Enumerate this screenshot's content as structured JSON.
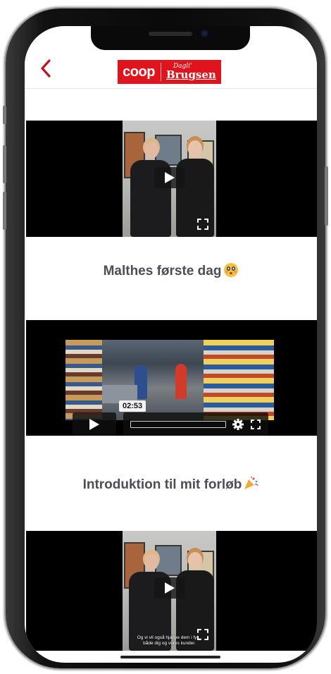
{
  "header": {
    "back_icon": "chevron-left-icon",
    "logo": {
      "primary": "coop",
      "secondary_top": "Dagli'",
      "secondary_bottom": "Brugsen"
    }
  },
  "feed": [
    {
      "caption": "Malthes første dag",
      "caption_emoji": "flushed-face-emoji",
      "player_state": "paused-poster"
    },
    {
      "caption": "Introduktion til mit forløb",
      "caption_emoji": "party-popper-emoji",
      "duration": "02:53",
      "player_state": "paused-controls"
    },
    {
      "player_state": "paused-poster",
      "subtitle_line1": "Og vi vil også hjælpe dem i fyl...",
      "subtitle_line2": "både dig og vores kunder."
    }
  ],
  "colors": {
    "brand_red": "#e1141e",
    "back_icon": "#c0141c",
    "caption_text": "#4a4e56"
  }
}
